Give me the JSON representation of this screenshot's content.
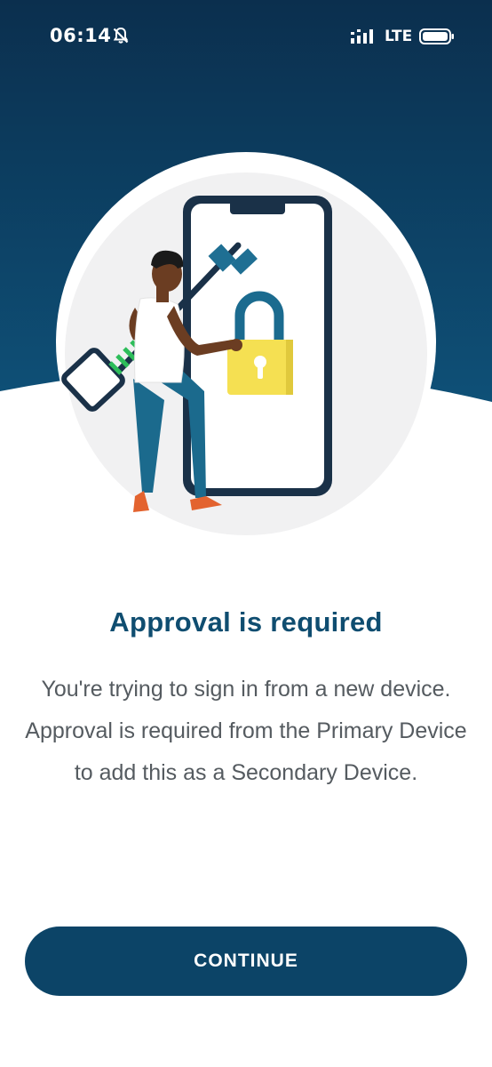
{
  "status_bar": {
    "time": "06:14",
    "network": "LTE",
    "icons": [
      "bell-muted-icon",
      "signal-icon",
      "battery-icon"
    ]
  },
  "illustration": {
    "subject": "person holding key next to phone with padlock",
    "icons": [
      "key-icon",
      "padlock-icon",
      "phone-icon"
    ]
  },
  "content": {
    "title": "Approval is required",
    "description": "You're trying to sign in from a new device. Approval is required from the Primary Device to add this as a Secondary Device."
  },
  "actions": {
    "continue_label": "CONTINUE"
  },
  "colors": {
    "header_top": "#0b2f4e",
    "header_bottom": "#0e5077",
    "primary": "#0c4467",
    "title": "#0f4d70",
    "body_text": "#555b60",
    "padlock": "#f5e052"
  }
}
